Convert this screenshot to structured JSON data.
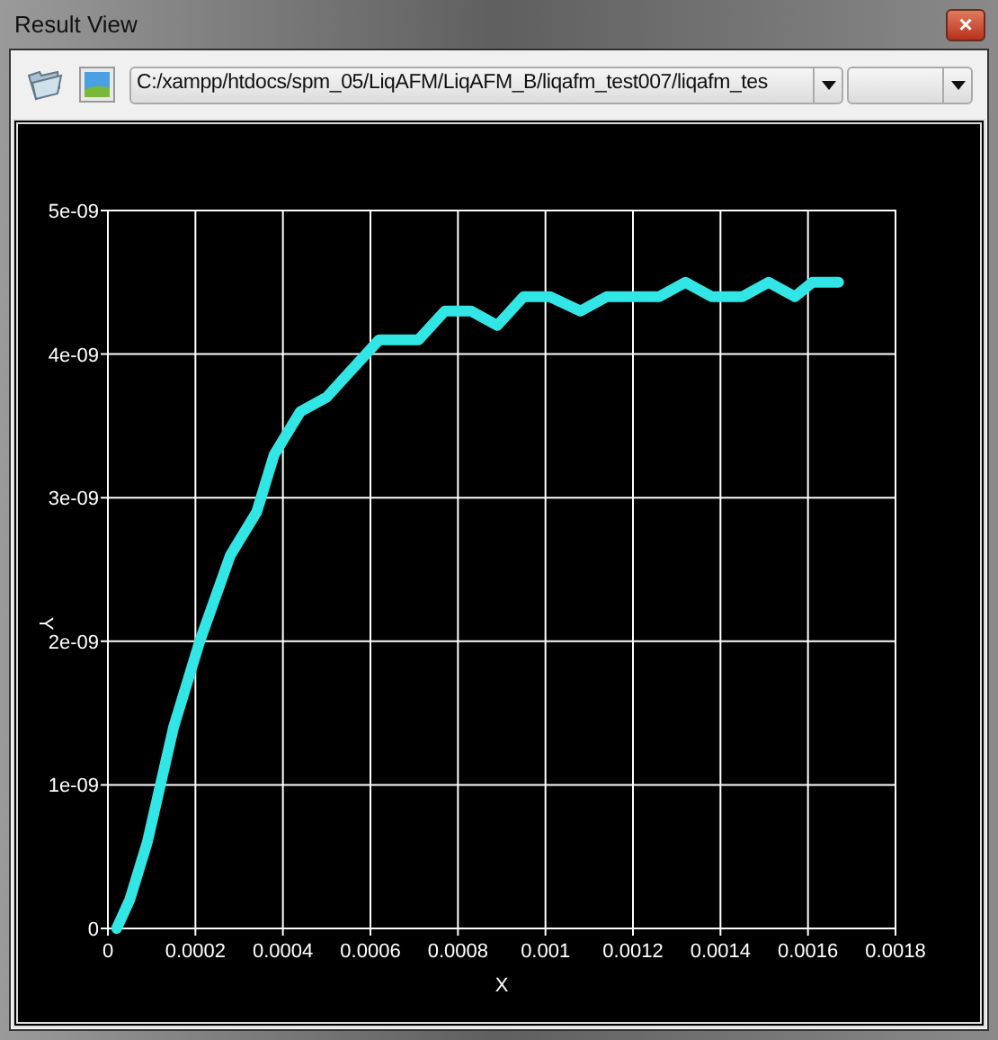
{
  "window": {
    "title": "Result View",
    "close": "×"
  },
  "toolbar": {
    "path": "C:/xampp/htdocs/spm_05/LiqAFM/LiqAFM_B/liqafm_test007/liqafm_tes"
  },
  "chart_data": {
    "type": "line",
    "grid": true,
    "xlabel": "X",
    "ylabel": "Y",
    "xlim": [
      0,
      0.0018
    ],
    "ylim": [
      0,
      5e-09
    ],
    "xticks": [
      0,
      0.0002,
      0.0004,
      0.0006,
      0.0008,
      0.001,
      0.0012,
      0.0014,
      0.0016,
      0.0018
    ],
    "yticks": [
      {
        "value": 0,
        "label": "0"
      },
      {
        "value": 1e-09,
        "label": "1e-09"
      },
      {
        "value": 2e-09,
        "label": "2e-09"
      },
      {
        "value": 3e-09,
        "label": "3e-09"
      },
      {
        "value": 4e-09,
        "label": "4e-09"
      },
      {
        "value": 5e-09,
        "label": "5e-09"
      }
    ],
    "x": [
      2e-05,
      5e-05,
      9e-05,
      0.00015,
      0.00021,
      0.00028,
      0.00034,
      0.00038,
      0.00044,
      0.0005,
      0.00056,
      0.00062,
      0.00071,
      0.00077,
      0.00083,
      0.00089,
      0.00095,
      0.00101,
      0.00108,
      0.00114,
      0.0012,
      0.00126,
      0.00132,
      0.00138,
      0.00145,
      0.00151,
      0.00157,
      0.00161,
      0.00167
    ],
    "series": [
      {
        "color": "#33e6e6",
        "values": [
          0,
          2e-10,
          6e-10,
          1.4e-09,
          2e-09,
          2.6e-09,
          2.9e-09,
          3.3e-09,
          3.6e-09,
          3.7e-09,
          3.9e-09,
          4.1e-09,
          4.1e-09,
          4.3e-09,
          4.3e-09,
          4.2e-09,
          4.4e-09,
          4.4e-09,
          4.3e-09,
          4.4e-09,
          4.4e-09,
          4.4e-09,
          4.5e-09,
          4.4e-09,
          4.4e-09,
          4.5e-09,
          4.4e-09,
          4.5e-09,
          4.5e-09
        ]
      }
    ]
  }
}
